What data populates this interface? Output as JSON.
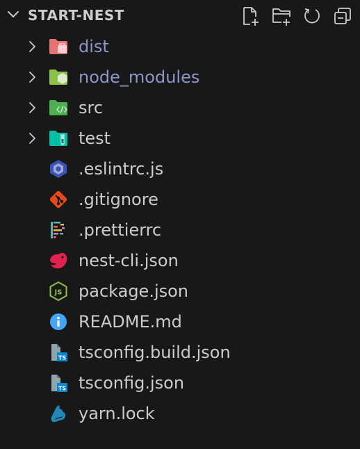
{
  "explorer": {
    "title": "START-NEST",
    "actions": [
      {
        "name": "new-file-icon"
      },
      {
        "name": "new-folder-icon"
      },
      {
        "name": "refresh-icon"
      },
      {
        "name": "collapse-all-icon"
      }
    ]
  },
  "tree": {
    "items": [
      {
        "label": "dist",
        "kind": "folder",
        "icon": "folder-dist-icon",
        "color": "#e57373",
        "ignored": true
      },
      {
        "label": "node_modules",
        "kind": "folder",
        "icon": "folder-node-icon",
        "color": "#8bc34a",
        "ignored": true
      },
      {
        "label": "src",
        "kind": "folder",
        "icon": "folder-src-icon",
        "color": "#4caf50",
        "ignored": false
      },
      {
        "label": "test",
        "kind": "folder",
        "icon": "folder-test-icon",
        "color": "#00bfa5",
        "ignored": false
      },
      {
        "label": ".eslintrc.js",
        "kind": "file",
        "icon": "eslint-icon",
        "color": "#3f51b5",
        "ignored": false
      },
      {
        "label": ".gitignore",
        "kind": "file",
        "icon": "git-icon",
        "color": "#e64a19",
        "ignored": false
      },
      {
        "label": ".prettierrc",
        "kind": "file",
        "icon": "prettier-icon",
        "color": "#56b3b4",
        "ignored": false
      },
      {
        "label": "nest-cli.json",
        "kind": "file",
        "icon": "nestjs-icon",
        "color": "#e0234e",
        "ignored": false
      },
      {
        "label": "package.json",
        "kind": "file",
        "icon": "nodejs-icon",
        "color": "#8bc34a",
        "ignored": false
      },
      {
        "label": "README.md",
        "kind": "file",
        "icon": "info-icon",
        "color": "#42a5f5",
        "ignored": false
      },
      {
        "label": "tsconfig.build.json",
        "kind": "file",
        "icon": "tsconfig-icon",
        "color": "#0288d1",
        "ignored": false
      },
      {
        "label": "tsconfig.json",
        "kind": "file",
        "icon": "tsconfig-icon",
        "color": "#0288d1",
        "ignored": false
      },
      {
        "label": "yarn.lock",
        "kind": "file",
        "icon": "yarn-icon",
        "color": "#2188b6",
        "ignored": false
      }
    ]
  }
}
